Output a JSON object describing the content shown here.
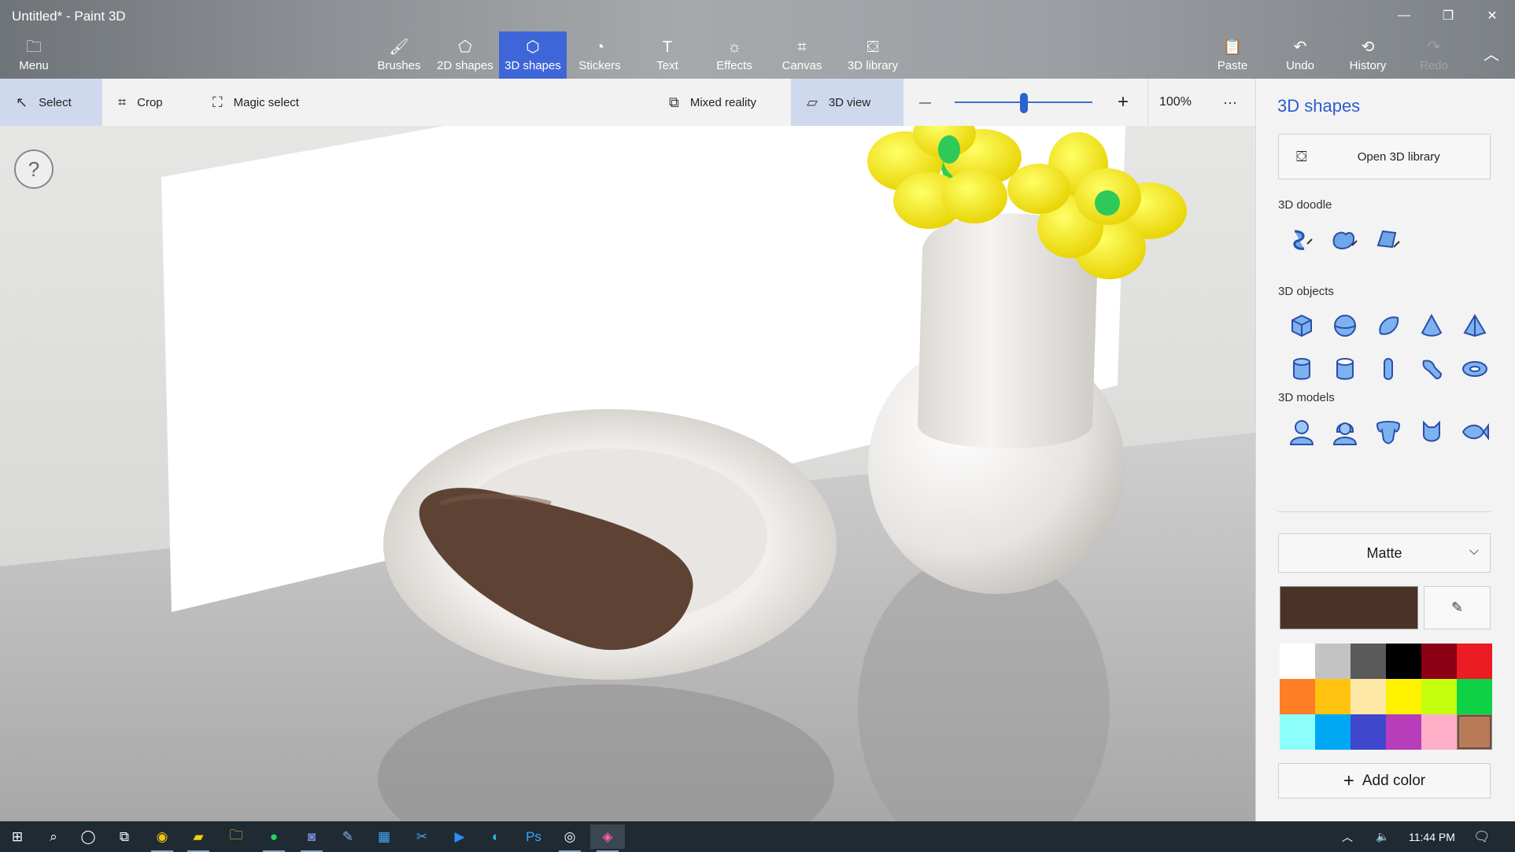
{
  "window": {
    "title": "Untitled* - Paint 3D",
    "controls": [
      "minimize",
      "restore",
      "close"
    ]
  },
  "ribbon": {
    "menu_label": "Menu",
    "tabs": [
      {
        "label": "Brushes",
        "icon": "brush-icon"
      },
      {
        "label": "2D shapes",
        "icon": "2d-shapes-icon"
      },
      {
        "label": "3D shapes",
        "icon": "3d-shapes-icon",
        "active": true
      },
      {
        "label": "Stickers",
        "icon": "stickers-icon"
      },
      {
        "label": "Text",
        "icon": "text-icon"
      },
      {
        "label": "Effects",
        "icon": "effects-icon"
      },
      {
        "label": "Canvas",
        "icon": "canvas-icon"
      },
      {
        "label": "3D library",
        "icon": "3d-library-icon"
      }
    ],
    "actions": [
      {
        "label": "Paste",
        "icon": "paste-icon"
      },
      {
        "label": "Undo",
        "icon": "undo-icon"
      },
      {
        "label": "History",
        "icon": "history-icon"
      },
      {
        "label": "Redo",
        "icon": "redo-icon",
        "disabled": true
      }
    ]
  },
  "toolbar": {
    "select_label": "Select",
    "crop_label": "Crop",
    "magic_select_label": "Magic select",
    "mixed_reality_label": "Mixed reality",
    "view_3d_label": "3D view",
    "zoom_minus": "—",
    "zoom_plus": "+",
    "zoom_value": "100%",
    "zoom_slider_fraction": 0.5,
    "more_label": "···"
  },
  "canvas": {
    "help_label": "?"
  },
  "panel": {
    "title": "3D shapes",
    "open_library_label": "Open 3D library",
    "doodle_section": "3D doodle",
    "objects_section": "3D objects",
    "models_section": "3D models",
    "doodle_items": [
      "sharp-edge-doodle-icon",
      "soft-edge-doodle-icon",
      "tube-doodle-icon"
    ],
    "object_items": [
      "cube-icon",
      "sphere-icon",
      "hemisphere-icon",
      "cone-icon",
      "pyramid-icon",
      "cylinder-icon",
      "tube-icon",
      "capsule-icon",
      "curved-tube-icon",
      "donut-icon"
    ],
    "model_items": [
      "man-model-icon",
      "woman-model-icon",
      "dog-model-icon",
      "cat-model-icon",
      "fish-model-icon"
    ],
    "material_label": "Matte",
    "current_color": "#4a3228",
    "palette": [
      "#ffffff",
      "#c3c3c3",
      "#5a5a5a",
      "#000000",
      "#8b0014",
      "#ec1c24",
      "#ff7f27",
      "#ffc20e",
      "#fde9a5",
      "#fff200",
      "#c4ff0e",
      "#0ed145",
      "#8cfffb",
      "#00a8f3",
      "#3f48cc",
      "#b83dba",
      "#ffaec8",
      "#b97a57"
    ],
    "selected_swatch": 17,
    "add_color_label": "Add color"
  },
  "taskbar": {
    "apps": [
      "windows-start-icon",
      "search-icon",
      "cortana-icon",
      "task-view-icon",
      "chrome-icon",
      "sticky-notes-icon",
      "file-explorer-icon",
      "spotify-icon",
      "discord-icon",
      "paint-app-icon",
      "calculator-icon",
      "snip-icon",
      "zoom-icon",
      "edge-icon",
      "photoshop-icon",
      "screen-recorder-icon",
      "paint-3d-icon"
    ],
    "time": "11:44 PM"
  }
}
